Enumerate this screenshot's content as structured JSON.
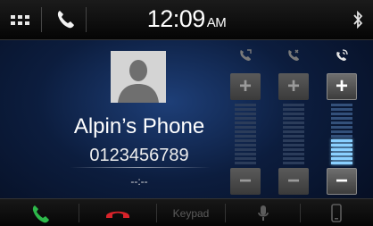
{
  "status_bar": {
    "time": "12:09",
    "ampm": "AM",
    "icons": {
      "menu": "grid-menu-icon",
      "phone": "phone-icon",
      "bluetooth": "bluetooth-icon"
    }
  },
  "contact": {
    "name": "Alpin’s Phone",
    "number": "0123456789",
    "duration": "--:--",
    "avatar": "contact-avatar-icon"
  },
  "volume": {
    "plus_label": "+",
    "minus_label": "−",
    "channels": [
      {
        "icon": "call-volume-icon",
        "level": 0.0,
        "active": false
      },
      {
        "icon": "mic-volume-icon",
        "level": 0.0,
        "active": false
      },
      {
        "icon": "ringtone-volume-icon",
        "level": 0.45,
        "active": true
      }
    ]
  },
  "bottom_bar": {
    "answer_icon": "answer-call-icon",
    "hangup_icon": "hangup-call-icon",
    "keypad_label": "Keypad",
    "mic_icon": "microphone-icon",
    "handset_icon": "handset-device-icon"
  },
  "colors": {
    "answer": "#2db84a",
    "hangup": "#d8232a",
    "volume_active": "#8ad0ff",
    "background": "#0c1d3e"
  }
}
